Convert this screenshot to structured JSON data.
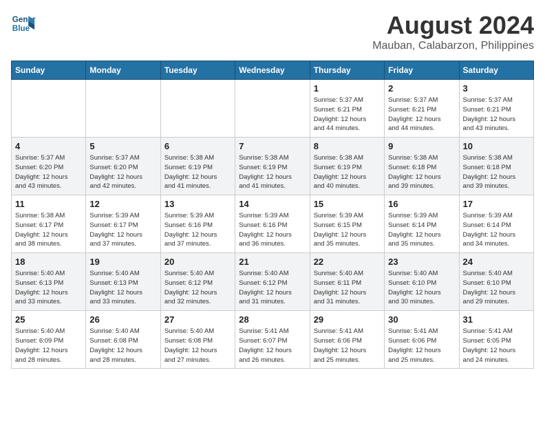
{
  "header": {
    "logo_line1": "General",
    "logo_line2": "Blue",
    "title": "August 2024",
    "subtitle": "Mauban, Calabarzon, Philippines"
  },
  "weekdays": [
    "Sunday",
    "Monday",
    "Tuesday",
    "Wednesday",
    "Thursday",
    "Friday",
    "Saturday"
  ],
  "weeks": [
    [
      {
        "day": "",
        "info": ""
      },
      {
        "day": "",
        "info": ""
      },
      {
        "day": "",
        "info": ""
      },
      {
        "day": "",
        "info": ""
      },
      {
        "day": "1",
        "info": "Sunrise: 5:37 AM\nSunset: 6:21 PM\nDaylight: 12 hours\nand 44 minutes."
      },
      {
        "day": "2",
        "info": "Sunrise: 5:37 AM\nSunset: 6:21 PM\nDaylight: 12 hours\nand 44 minutes."
      },
      {
        "day": "3",
        "info": "Sunrise: 5:37 AM\nSunset: 6:21 PM\nDaylight: 12 hours\nand 43 minutes."
      }
    ],
    [
      {
        "day": "4",
        "info": "Sunrise: 5:37 AM\nSunset: 6:20 PM\nDaylight: 12 hours\nand 43 minutes."
      },
      {
        "day": "5",
        "info": "Sunrise: 5:37 AM\nSunset: 6:20 PM\nDaylight: 12 hours\nand 42 minutes."
      },
      {
        "day": "6",
        "info": "Sunrise: 5:38 AM\nSunset: 6:19 PM\nDaylight: 12 hours\nand 41 minutes."
      },
      {
        "day": "7",
        "info": "Sunrise: 5:38 AM\nSunset: 6:19 PM\nDaylight: 12 hours\nand 41 minutes."
      },
      {
        "day": "8",
        "info": "Sunrise: 5:38 AM\nSunset: 6:19 PM\nDaylight: 12 hours\nand 40 minutes."
      },
      {
        "day": "9",
        "info": "Sunrise: 5:38 AM\nSunset: 6:18 PM\nDaylight: 12 hours\nand 39 minutes."
      },
      {
        "day": "10",
        "info": "Sunrise: 5:38 AM\nSunset: 6:18 PM\nDaylight: 12 hours\nand 39 minutes."
      }
    ],
    [
      {
        "day": "11",
        "info": "Sunrise: 5:38 AM\nSunset: 6:17 PM\nDaylight: 12 hours\nand 38 minutes."
      },
      {
        "day": "12",
        "info": "Sunrise: 5:39 AM\nSunset: 6:17 PM\nDaylight: 12 hours\nand 37 minutes."
      },
      {
        "day": "13",
        "info": "Sunrise: 5:39 AM\nSunset: 6:16 PM\nDaylight: 12 hours\nand 37 minutes."
      },
      {
        "day": "14",
        "info": "Sunrise: 5:39 AM\nSunset: 6:16 PM\nDaylight: 12 hours\nand 36 minutes."
      },
      {
        "day": "15",
        "info": "Sunrise: 5:39 AM\nSunset: 6:15 PM\nDaylight: 12 hours\nand 35 minutes."
      },
      {
        "day": "16",
        "info": "Sunrise: 5:39 AM\nSunset: 6:14 PM\nDaylight: 12 hours\nand 35 minutes."
      },
      {
        "day": "17",
        "info": "Sunrise: 5:39 AM\nSunset: 6:14 PM\nDaylight: 12 hours\nand 34 minutes."
      }
    ],
    [
      {
        "day": "18",
        "info": "Sunrise: 5:40 AM\nSunset: 6:13 PM\nDaylight: 12 hours\nand 33 minutes."
      },
      {
        "day": "19",
        "info": "Sunrise: 5:40 AM\nSunset: 6:13 PM\nDaylight: 12 hours\nand 33 minutes."
      },
      {
        "day": "20",
        "info": "Sunrise: 5:40 AM\nSunset: 6:12 PM\nDaylight: 12 hours\nand 32 minutes."
      },
      {
        "day": "21",
        "info": "Sunrise: 5:40 AM\nSunset: 6:12 PM\nDaylight: 12 hours\nand 31 minutes."
      },
      {
        "day": "22",
        "info": "Sunrise: 5:40 AM\nSunset: 6:11 PM\nDaylight: 12 hours\nand 31 minutes."
      },
      {
        "day": "23",
        "info": "Sunrise: 5:40 AM\nSunset: 6:10 PM\nDaylight: 12 hours\nand 30 minutes."
      },
      {
        "day": "24",
        "info": "Sunrise: 5:40 AM\nSunset: 6:10 PM\nDaylight: 12 hours\nand 29 minutes."
      }
    ],
    [
      {
        "day": "25",
        "info": "Sunrise: 5:40 AM\nSunset: 6:09 PM\nDaylight: 12 hours\nand 28 minutes."
      },
      {
        "day": "26",
        "info": "Sunrise: 5:40 AM\nSunset: 6:08 PM\nDaylight: 12 hours\nand 28 minutes."
      },
      {
        "day": "27",
        "info": "Sunrise: 5:40 AM\nSunset: 6:08 PM\nDaylight: 12 hours\nand 27 minutes."
      },
      {
        "day": "28",
        "info": "Sunrise: 5:41 AM\nSunset: 6:07 PM\nDaylight: 12 hours\nand 26 minutes."
      },
      {
        "day": "29",
        "info": "Sunrise: 5:41 AM\nSunset: 6:06 PM\nDaylight: 12 hours\nand 25 minutes."
      },
      {
        "day": "30",
        "info": "Sunrise: 5:41 AM\nSunset: 6:06 PM\nDaylight: 12 hours\nand 25 minutes."
      },
      {
        "day": "31",
        "info": "Sunrise: 5:41 AM\nSunset: 6:05 PM\nDaylight: 12 hours\nand 24 minutes."
      }
    ]
  ]
}
